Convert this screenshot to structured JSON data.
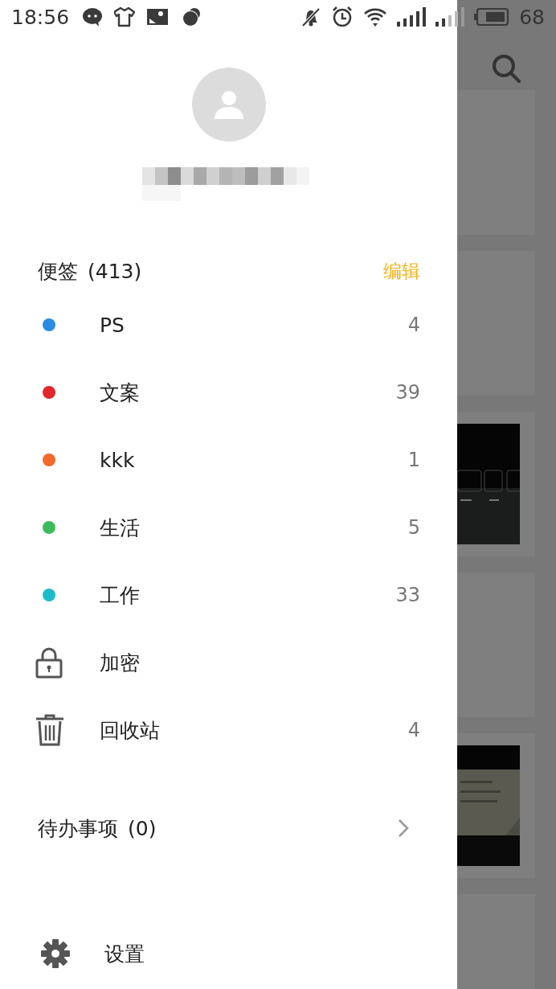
{
  "status_bar": {
    "time": "18:56",
    "battery": "68"
  },
  "drawer": {
    "header": {
      "title": "便签",
      "count": "(413)",
      "edit": "编辑"
    },
    "folders": [
      {
        "kind": "tag",
        "label": "PS",
        "count": "4",
        "color": "#2b8be3"
      },
      {
        "kind": "tag",
        "label": "文案",
        "count": "39",
        "color": "#e3262b"
      },
      {
        "kind": "tag",
        "label": "kkk",
        "count": "1",
        "color": "#f2692a"
      },
      {
        "kind": "tag",
        "label": "生活",
        "count": "5",
        "color": "#3dbb5b"
      },
      {
        "kind": "tag",
        "label": "工作",
        "count": "33",
        "color": "#1bbcc9"
      },
      {
        "kind": "lock",
        "label": "加密"
      },
      {
        "kind": "trash",
        "label": "回收站",
        "count": "4"
      }
    ],
    "todo": {
      "label": "待办事项",
      "count": "(0)"
    },
    "settings": {
      "label": "设置"
    }
  },
  "background": {
    "cards": [
      {
        "kind": "blank"
      },
      {
        "kind": "blank"
      },
      {
        "kind": "picture"
      },
      {
        "kind": "blank"
      },
      {
        "kind": "picture"
      },
      {
        "kind": "blank"
      }
    ]
  }
}
